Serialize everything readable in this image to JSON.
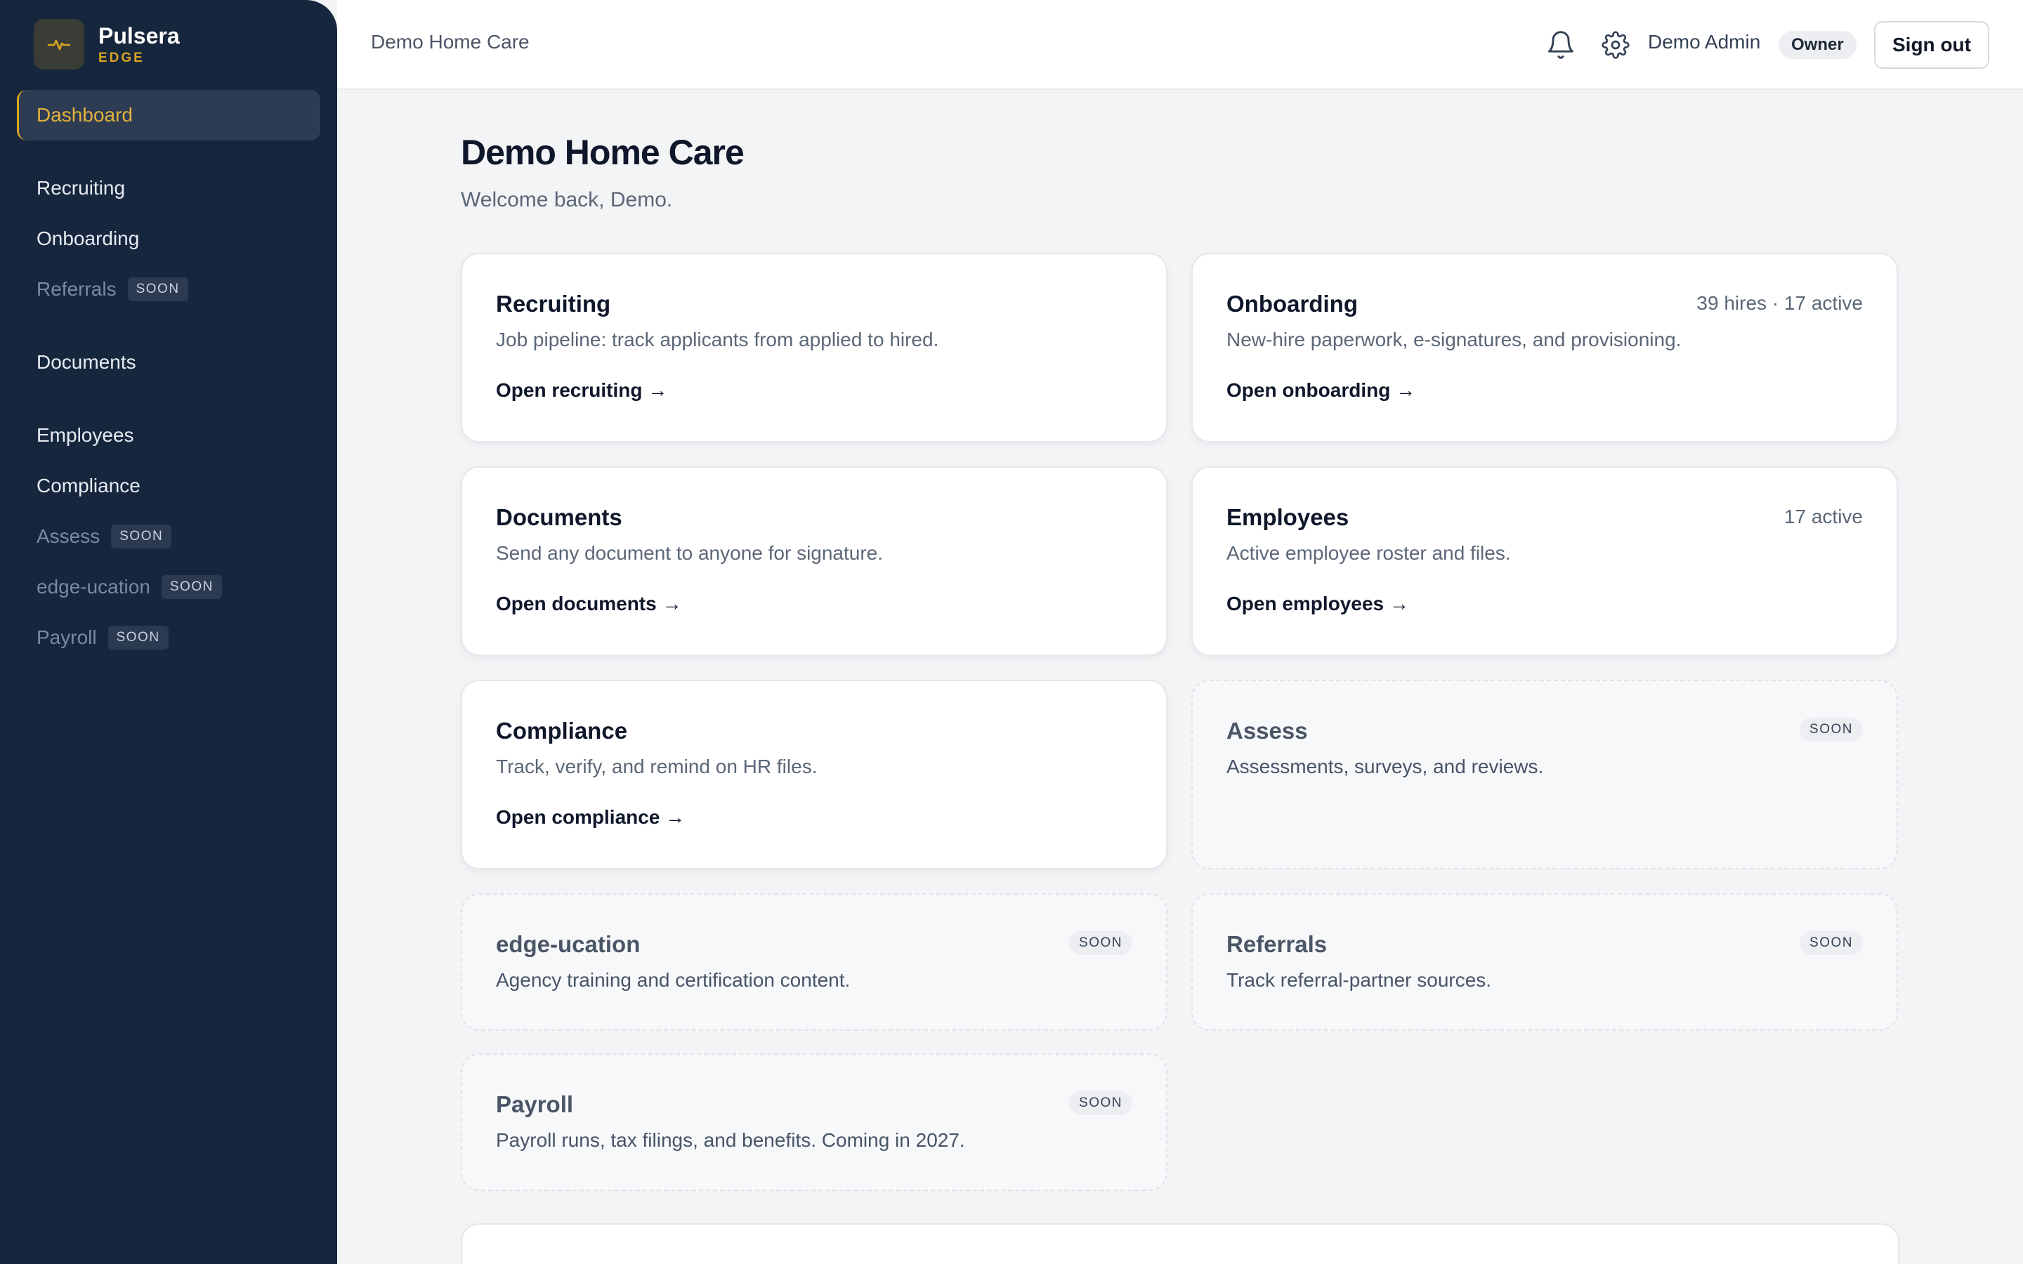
{
  "brand": {
    "name": "Pulsera",
    "sub": "EDGE"
  },
  "sidebar": {
    "active": "Dashboard",
    "items": [
      {
        "label": "Recruiting"
      },
      {
        "label": "Onboarding"
      },
      {
        "label": "Referrals",
        "badge": "SOON"
      },
      {
        "label": "Documents"
      },
      {
        "label": "Employees"
      },
      {
        "label": "Compliance"
      },
      {
        "label": "Assess",
        "badge": "SOON"
      },
      {
        "label": "edge-ucation",
        "badge": "SOON"
      },
      {
        "label": "Payroll",
        "badge": "SOON"
      }
    ]
  },
  "header": {
    "org": "Demo Home Care",
    "user": "Demo Admin",
    "role": "Owner",
    "signout": "Sign out"
  },
  "main": {
    "title": "Demo Home Care",
    "welcome": "Welcome back, Demo.",
    "cards": [
      {
        "title": "Recruiting",
        "desc": "Job pipeline: track applicants from applied to hired.",
        "link": "Open recruiting →"
      },
      {
        "title": "Onboarding",
        "desc": "New-hire paperwork, e-signatures, and provisioning.",
        "link": "Open onboarding →",
        "meta": "39 hires · 17 active"
      },
      {
        "title": "Documents",
        "desc": "Send any document to anyone for signature.",
        "link": "Open documents →"
      },
      {
        "title": "Employees",
        "desc": "Active employee roster and files.",
        "link": "Open employees →",
        "meta": "17 active"
      },
      {
        "title": "Compliance",
        "desc": "Track, verify, and remind on HR files.",
        "link": "Open compliance →"
      },
      {
        "title": "Assess",
        "desc": "Assessments, surveys, and reviews.",
        "badge": "SOON"
      },
      {
        "title": "edge-ucation",
        "desc": "Agency training and certification content.",
        "badge": "SOON"
      },
      {
        "title": "Referrals",
        "desc": "Track referral-partner sources.",
        "badge": "SOON"
      },
      {
        "title": "Payroll",
        "desc": "Payroll runs, tax filings, and benefits. Coming in 2027.",
        "badge": "SOON"
      }
    ]
  },
  "colors": {
    "sidebar": "#16263d",
    "accent": "#d9a520",
    "background": "#f3f4f6"
  },
  "icons": {
    "logo": "pulse-icon",
    "notifications": "bell-icon",
    "settings": "gear-icon"
  }
}
